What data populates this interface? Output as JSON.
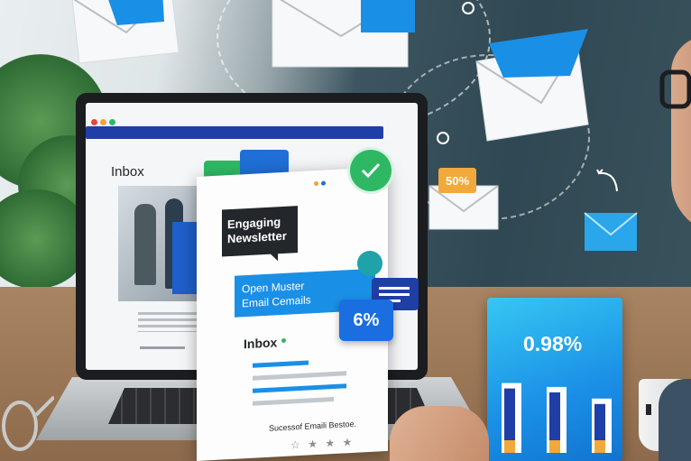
{
  "screen": {
    "inbox_label": "Inbox"
  },
  "card": {
    "headline": "Engaging Newsletter",
    "banner_line1": "Open Muster",
    "banner_line2": "Email Cemails",
    "inbox_label": "Inbox",
    "footer_text": "Sucessof Emaili Bestoe.",
    "stars": [
      "☆",
      "★",
      "★",
      "★"
    ]
  },
  "badges": {
    "percent_badge": "6%",
    "envelope_badge": "50%",
    "panel_value": "0.98%"
  },
  "chart_data": {
    "type": "bar",
    "categories": [
      "",
      "",
      ""
    ],
    "values": [
      0.9,
      0.85,
      0.7
    ],
    "title": "0.98%",
    "xlabel": "",
    "ylabel": "",
    "ylim": [
      0,
      1
    ]
  },
  "colors": {
    "blue": "#1a8fe6",
    "navy": "#1f3ea6",
    "green": "#2fb864",
    "orange": "#f2a93b",
    "dark_label": "#23262b"
  },
  "icons": [
    "envelope-icon",
    "check-icon",
    "chat-bubble-icon",
    "link-icon"
  ]
}
